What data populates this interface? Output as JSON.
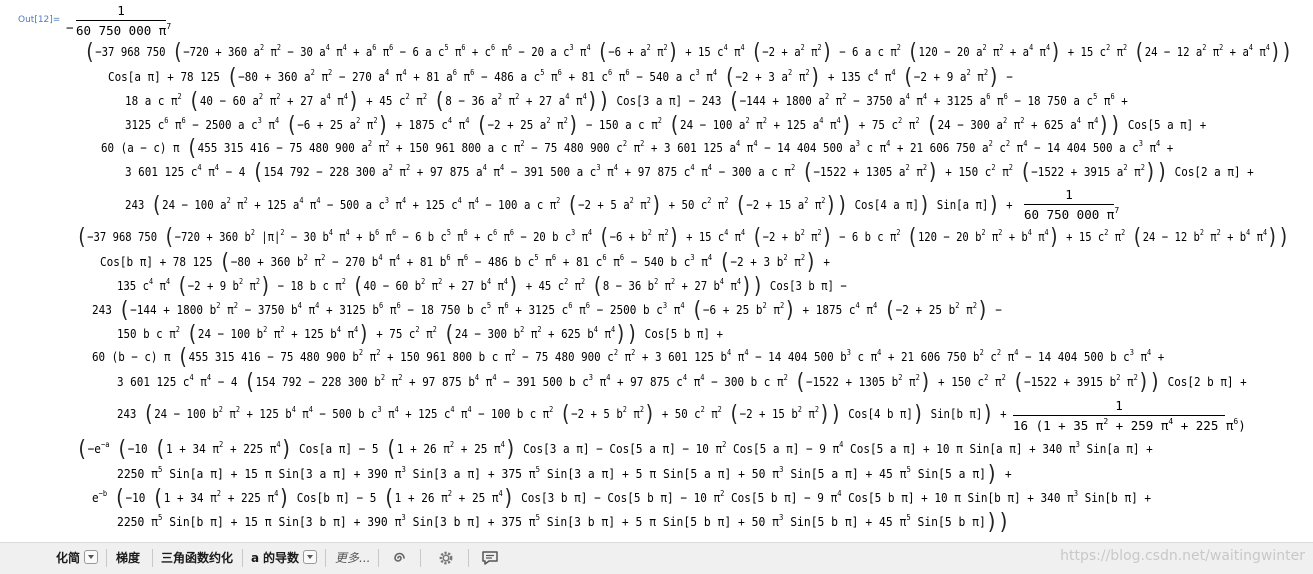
{
  "cell": {
    "out_label": "Out[12]="
  },
  "expression": {
    "lead_sign": "−",
    "frac1": {
      "num": "1",
      "den": "60 750 000 π<sup>7</sup>"
    },
    "frac2": {
      "num": "1",
      "den": "60 750 000 π<sup>7</sup>"
    },
    "frac3": {
      "num": "1",
      "den": "16 (1 + 35 π<sup>2</sup> + 259 π<sup>4</sup> + 225 π<sup>6</sup>)"
    },
    "lines": [
      "<span class=\"big\">(</span>−37 968 750 <span class=\"big\">(</span>−720 + 360 a<sup>2</sup> π<sup>2</sup> − 30 a<sup>4</sup> π<sup>4</sup> + a<sup>6</sup> π<sup>6</sup> − 6 a c<sup>5</sup> π<sup>6</sup> + c<sup>6</sup> π<sup>6</sup> − 20 a c<sup>3</sup> π<sup>4</sup> <span class=\"big\">(</span>−6 + a<sup>2</sup> π<sup>2</sup><span class=\"big\">)</span> + 15 c<sup>4</sup> π<sup>4</sup> <span class=\"big\">(</span>−2 + a<sup>2</sup> π<sup>2</sup><span class=\"big\">)</span> − 6 a c π<sup>2</sup> <span class=\"big\">(</span>120 − 20 a<sup>2</sup> π<sup>2</sup> + a<sup>4</sup> π<sup>4</sup><span class=\"big\">)</span> + 15 c<sup>2</sup> π<sup>2</sup> <span class=\"big\">(</span>24 − 12 a<sup>2</sup> π<sup>2</sup> + a<sup>4</sup> π<sup>4</sup><span class=\"big\">))</span>",
      "Cos[a π] + 78 125 <span class=\"big\">(</span>−80 + 360 a<sup>2</sup> π<sup>2</sup> − 270 a<sup>4</sup> π<sup>4</sup> + 81 a<sup>6</sup> π<sup>6</sup> − 486 a c<sup>5</sup> π<sup>6</sup> + 81 c<sup>6</sup> π<sup>6</sup> − 540 a c<sup>3</sup> π<sup>4</sup> <span class=\"big\">(</span>−2 + 3 a<sup>2</sup> π<sup>2</sup><span class=\"big\">)</span> + 135 c<sup>4</sup> π<sup>4</sup> <span class=\"big\">(</span>−2 + 9 a<sup>2</sup> π<sup>2</sup><span class=\"big\">)</span> −",
      "18 a c π<sup>2</sup> <span class=\"big\">(</span>40 − 60 a<sup>2</sup> π<sup>2</sup> + 27 a<sup>4</sup> π<sup>4</sup><span class=\"big\">)</span> + 45 c<sup>2</sup> π<sup>2</sup> <span class=\"big\">(</span>8 − 36 a<sup>2</sup> π<sup>2</sup> + 27 a<sup>4</sup> π<sup>4</sup><span class=\"big\">))</span> Cos[3 a π] − 243 <span class=\"big\">(</span>−144 + 1800 a<sup>2</sup> π<sup>2</sup> − 3750 a<sup>4</sup> π<sup>4</sup> + 3125 a<sup>6</sup> π<sup>6</sup> − 18 750 a c<sup>5</sup> π<sup>6</sup> +",
      "3125 c<sup>6</sup> π<sup>6</sup> − 2500 a c<sup>3</sup> π<sup>4</sup> <span class=\"big\">(</span>−6 + 25 a<sup>2</sup> π<sup>2</sup><span class=\"big\">)</span> + 1875 c<sup>4</sup> π<sup>4</sup> <span class=\"big\">(</span>−2 + 25 a<sup>2</sup> π<sup>2</sup><span class=\"big\">)</span> − 150 a c π<sup>2</sup> <span class=\"big\">(</span>24 − 100 a<sup>2</sup> π<sup>2</sup> + 125 a<sup>4</sup> π<sup>4</sup><span class=\"big\">)</span> + 75 c<sup>2</sup> π<sup>2</sup> <span class=\"big\">(</span>24 − 300 a<sup>2</sup> π<sup>2</sup> + 625 a<sup>4</sup> π<sup>4</sup><span class=\"big\">))</span> Cos[5 a π] +",
      "60 (a − c) π <span class=\"big\">(</span>455 315 416 − 75 480 900 a<sup>2</sup> π<sup>2</sup> + 150 961 800 a c π<sup>2</sup> − 75 480 900 c<sup>2</sup> π<sup>2</sup> + 3 601 125 a<sup>4</sup> π<sup>4</sup> − 14 404 500 a<sup>3</sup> c π<sup>4</sup> + 21 606 750 a<sup>2</sup> c<sup>2</sup> π<sup>4</sup> − 14 404 500 a c<sup>3</sup> π<sup>4</sup> +",
      "3 601 125 c<sup>4</sup> π<sup>4</sup> − 4 <span class=\"big\">(</span>154 792 − 228 300 a<sup>2</sup> π<sup>2</sup> + 97 875 a<sup>4</sup> π<sup>4</sup> − 391 500 a c<sup>3</sup> π<sup>4</sup> + 97 875 c<sup>4</sup> π<sup>4</sup> − 300 a c π<sup>2</sup> <span class=\"big\">(</span>−1522 + 1305 a<sup>2</sup> π<sup>2</sup><span class=\"big\">)</span> + 150 c<sup>2</sup> π<sup>2</sup> <span class=\"big\">(</span>−1522 + 3915 a<sup>2</sup> π<sup>2</sup><span class=\"big\">))</span> Cos[2 a π] +",
      "243 <span class=\"big\">(</span>24 − 100 a<sup>2</sup> π<sup>2</sup> + 125 a<sup>4</sup> π<sup>4</sup> − 500 a c<sup>3</sup> π<sup>4</sup> + 125 c<sup>4</sup> π<sup>4</sup> − 100 a c π<sup>2</sup> <span class=\"big\">(</span>−2 + 5 a<sup>2</sup> π<sup>2</sup><span class=\"big\">)</span> + 50 c<sup>2</sup> π<sup>2</sup> <span class=\"big\">(</span>−2 + 15 a<sup>2</sup> π<sup>2</sup><span class=\"big\">))</span> Cos[4 a π]<span class=\"big\">)</span> Sin[a π]<span class=\"big\">)</span> +",
      "<span class=\"big\">(</span>−37 968 750 <span class=\"big\">(</span>−720 + 360 b<sup>2</sup> |π|<sup>2</sup> − 30 b<sup>4</sup> π<sup>4</sup> + b<sup>6</sup> π<sup>6</sup> − 6 b c<sup>5</sup> π<sup>6</sup> + c<sup>6</sup> π<sup>6</sup> − 20 b c<sup>3</sup> π<sup>4</sup> <span class=\"big\">(</span>−6 + b<sup>2</sup> π<sup>2</sup><span class=\"big\">)</span> + 15 c<sup>4</sup> π<sup>4</sup> <span class=\"big\">(</span>−2 + b<sup>2</sup> π<sup>2</sup><span class=\"big\">)</span> − 6 b c π<sup>2</sup> <span class=\"big\">(</span>120 − 20 b<sup>2</sup> π<sup>2</sup> + b<sup>4</sup> π<sup>4</sup><span class=\"big\">)</span> + 15 c<sup>2</sup> π<sup>2</sup> <span class=\"big\">(</span>24 − 12 b<sup>2</sup> π<sup>2</sup> + b<sup>4</sup> π<sup>4</sup><span class=\"big\">))</span>",
      "Cos[b π] + 78 125 <span class=\"big\">(</span>−80 + 360 b<sup>2</sup> π<sup>2</sup> − 270 b<sup>4</sup> π<sup>4</sup> + 81 b<sup>6</sup> π<sup>6</sup> − 486 b c<sup>5</sup> π<sup>6</sup> + 81 c<sup>6</sup> π<sup>6</sup> − 540 b c<sup>3</sup> π<sup>4</sup> <span class=\"big\">(</span>−2 + 3 b<sup>2</sup> π<sup>2</sup><span class=\"big\">)</span> +",
      "135 c<sup>4</sup> π<sup>4</sup> <span class=\"big\">(</span>−2 + 9 b<sup>2</sup> π<sup>2</sup><span class=\"big\">)</span> − 18 b c π<sup>2</sup> <span class=\"big\">(</span>40 − 60 b<sup>2</sup> π<sup>2</sup> + 27 b<sup>4</sup> π<sup>4</sup><span class=\"big\">)</span> + 45 c<sup>2</sup> π<sup>2</sup> <span class=\"big\">(</span>8 − 36 b<sup>2</sup> π<sup>2</sup> + 27 b<sup>4</sup> π<sup>4</sup><span class=\"big\">))</span> Cos[3 b π] −",
      "243 <span class=\"big\">(</span>−144 + 1800 b<sup>2</sup> π<sup>2</sup> − 3750 b<sup>4</sup> π<sup>4</sup> + 3125 b<sup>6</sup> π<sup>6</sup> − 18 750 b c<sup>5</sup> π<sup>6</sup> + 3125 c<sup>6</sup> π<sup>6</sup> − 2500 b c<sup>3</sup> π<sup>4</sup> <span class=\"big\">(</span>−6 + 25 b<sup>2</sup> π<sup>2</sup><span class=\"big\">)</span> + 1875 c<sup>4</sup> π<sup>4</sup> <span class=\"big\">(</span>−2 + 25 b<sup>2</sup> π<sup>2</sup><span class=\"big\">)</span> −",
      "150 b c π<sup>2</sup> <span class=\"big\">(</span>24 − 100 b<sup>2</sup> π<sup>2</sup> + 125 b<sup>4</sup> π<sup>4</sup><span class=\"big\">)</span> + 75 c<sup>2</sup> π<sup>2</sup> <span class=\"big\">(</span>24 − 300 b<sup>2</sup> π<sup>2</sup> + 625 b<sup>4</sup> π<sup>4</sup><span class=\"big\">))</span> Cos[5 b π] +",
      "60 (b − c) π <span class=\"big\">(</span>455 315 416 − 75 480 900 b<sup>2</sup> π<sup>2</sup> + 150 961 800 b c π<sup>2</sup> − 75 480 900 c<sup>2</sup> π<sup>2</sup> + 3 601 125 b<sup>4</sup> π<sup>4</sup> − 14 404 500 b<sup>3</sup> c π<sup>4</sup> + 21 606 750 b<sup>2</sup> c<sup>2</sup> π<sup>4</sup> − 14 404 500 b c<sup>3</sup> π<sup>4</sup> +",
      "3 601 125 c<sup>4</sup> π<sup>4</sup> − 4 <span class=\"big\">(</span>154 792 − 228 300 b<sup>2</sup> π<sup>2</sup> + 97 875 b<sup>4</sup> π<sup>4</sup> − 391 500 b c<sup>3</sup> π<sup>4</sup> + 97 875 c<sup>4</sup> π<sup>4</sup> − 300 b c π<sup>2</sup> <span class=\"big\">(</span>−1522 + 1305 b<sup>2</sup> π<sup>2</sup><span class=\"big\">)</span> + 150 c<sup>2</sup> π<sup>2</sup> <span class=\"big\">(</span>−1522 + 3915 b<sup>2</sup> π<sup>2</sup><span class=\"big\">))</span> Cos[2 b π] +",
      "243 <span class=\"big\">(</span>24 − 100 b<sup>2</sup> π<sup>2</sup> + 125 b<sup>4</sup> π<sup>4</sup> − 500 b c<sup>3</sup> π<sup>4</sup> + 125 c<sup>4</sup> π<sup>4</sup> − 100 b c π<sup>2</sup> <span class=\"big\">(</span>−2 + 5 b<sup>2</sup> π<sup>2</sup><span class=\"big\">)</span> + 50 c<sup>2</sup> π<sup>2</sup> <span class=\"big\">(</span>−2 + 15 b<sup>2</sup> π<sup>2</sup><span class=\"big\">))</span> Cos[4 b π]<span class=\"big\">)</span> Sin[b π]<span class=\"big\">)</span> +",
      "<span class=\"big\">(</span>−e<sup>−a</sup> <span class=\"big\">(</span>−10 <span class=\"big\">(</span>1 + 34 π<sup>2</sup> + 225 π<sup>4</sup><span class=\"big\">)</span> Cos[a π] − 5 <span class=\"big\">(</span>1 + 26 π<sup>2</sup> + 25 π<sup>4</sup><span class=\"big\">)</span> Cos[3 a π] − Cos[5 a π] − 10 π<sup>2</sup> Cos[5 a π] − 9 π<sup>4</sup> Cos[5 a π] + 10 π Sin[a π] + 340 π<sup>3</sup> Sin[a π] +",
      "2250 π<sup>5</sup> Sin[a π] + 15 π Sin[3 a π] + 390 π<sup>3</sup> Sin[3 a π] + 375 π<sup>5</sup> Sin[3 a π] + 5 π Sin[5 a π] + 50 π<sup>3</sup> Sin[5 a π] + 45 π<sup>5</sup> Sin[5 a π]<span class=\"big\">)</span> +",
      "e<sup>−b</sup> <span class=\"big\">(</span>−10 <span class=\"big\">(</span>1 + 34 π<sup>2</sup> + 225 π<sup>4</sup><span class=\"big\">)</span> Cos[b π] − 5 <span class=\"big\">(</span>1 + 26 π<sup>2</sup> + 25 π<sup>4</sup><span class=\"big\">)</span> Cos[3 b π] − Cos[5 b π] − 10 π<sup>2</sup> Cos[5 b π] − 9 π<sup>4</sup> Cos[5 b π] + 10 π Sin[b π] + 340 π<sup>3</sup> Sin[b π] +",
      "2250 π<sup>5</sup> Sin[b π] + 15 π Sin[3 b π] + 390 π<sup>3</sup> Sin[3 b π] + 375 π<sup>5</sup> Sin[3 b π] + 5 π Sin[5 b π] + 50 π<sup>3</sup> Sin[5 b π] + 45 π<sup>5</sup> Sin[5 b π]<span class=\"big\">))</span>"
    ]
  },
  "toolbar": {
    "simplify": "化简",
    "gradient": "梯度",
    "trig_reduce": "三角函数约化",
    "derivative_prefix": "a",
    "derivative_label": "的导数",
    "more": "更多..."
  },
  "watermark": "https://blog.csdn.net/waitingwinter"
}
